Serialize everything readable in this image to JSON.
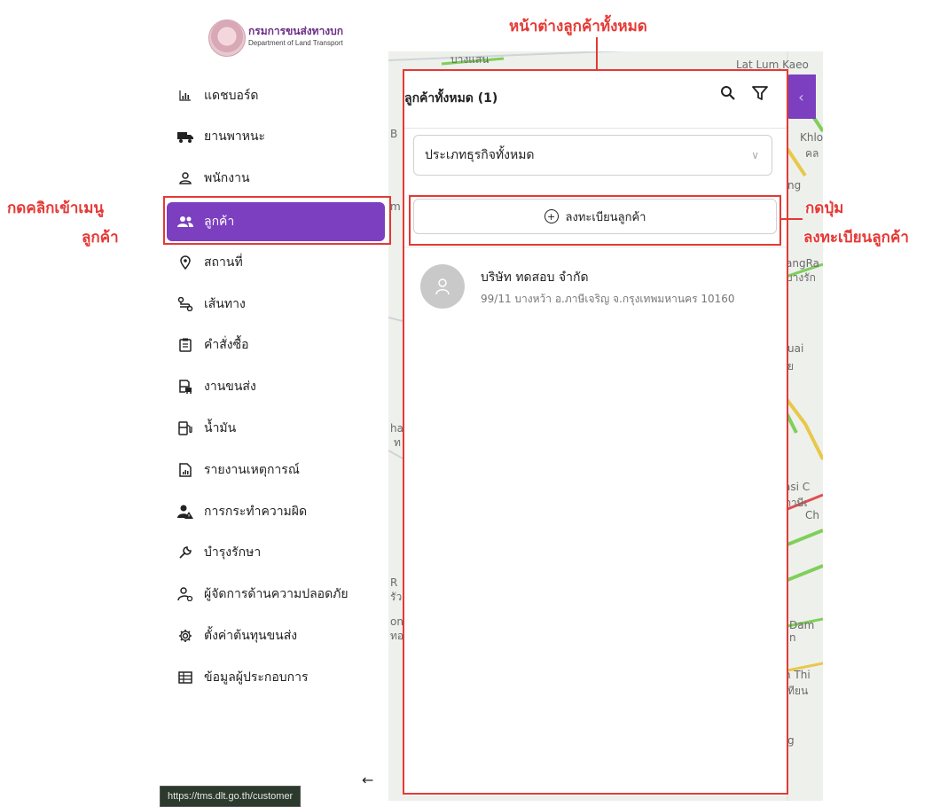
{
  "brand": {
    "name_th": "กรมการขนส่งทางบก",
    "name_en": "Department of Land Transport"
  },
  "menu": [
    {
      "label": "แดชบอร์ด",
      "icon": "bar-chart-icon",
      "active": false
    },
    {
      "label": "ยานพาหนะ",
      "icon": "truck-icon",
      "active": false
    },
    {
      "label": "พนักงาน",
      "icon": "person-icon",
      "active": false
    },
    {
      "label": "ลูกค้า",
      "icon": "users-icon",
      "active": true
    },
    {
      "label": "สถานที่",
      "icon": "location-pin-icon",
      "active": false
    },
    {
      "label": "เส้นทาง",
      "icon": "route-icon",
      "active": false
    },
    {
      "label": "คำสั่งซื้อ",
      "icon": "clipboard-icon",
      "active": false
    },
    {
      "label": "งานขนส่ง",
      "icon": "delivery-icon",
      "active": false
    },
    {
      "label": "น้ำมัน",
      "icon": "fuel-pump-icon",
      "active": false
    },
    {
      "label": "รายงานเหตุการณ์",
      "icon": "report-file-icon",
      "active": false
    },
    {
      "label": "การกระทำความผิด",
      "icon": "person-warning-icon",
      "active": false
    },
    {
      "label": "บำรุงรักษา",
      "icon": "wrench-icon",
      "active": false
    },
    {
      "label": "ผู้จัดการด้านความปลอดภัย",
      "icon": "safety-manager-icon",
      "active": false
    },
    {
      "label": "ตั้งค่าต้นทุนขนส่ง",
      "icon": "gear-icon",
      "active": false
    },
    {
      "label": "ข้อมูลผู้ประกอบการ",
      "icon": "building-icon",
      "active": false
    }
  ],
  "status_url": "https://tms.dlt.go.th/customer",
  "panel": {
    "title": "ลูกค้าทั้งหมด (1)",
    "filter_value": "ประเภทธุรกิจทั้งหมด",
    "register_button": "ลงทะเบียนลูกค้า",
    "customers": [
      {
        "name": "บริษัท ทดสอบ จำกัด",
        "address": "99/11 บางหว้า อ.ภาษีเจริญ จ.กรุงเทพมหานคร 10160"
      }
    ]
  },
  "annotations": {
    "panel_label": "หน้าต่างลูกค้าทั้งหมด",
    "menu_label_1": "กดคลิกเข้าเมนู",
    "menu_label_2": "ลูกค้า",
    "button_label_1": "กดปุ่ม",
    "button_label_2": "ลงทะเบียนลูกค้า",
    "color": "#e53935"
  },
  "map_labels": [
    "บางแสน",
    "Lat Lum Kaeo",
    "Khlo",
    "คล",
    "ng",
    "angRa",
    "บางรัก",
    "uai",
    "ย",
    "ha",
    "ท",
    "asi C",
    "ภาษีเ",
    "Ch",
    "R",
    "รัว",
    "on",
    "ทอ",
    "Dam",
    "n",
    "n Thi",
    "เทียน",
    "g",
    "B",
    "m"
  ],
  "theme": {
    "accent": "#7b3fbf"
  }
}
